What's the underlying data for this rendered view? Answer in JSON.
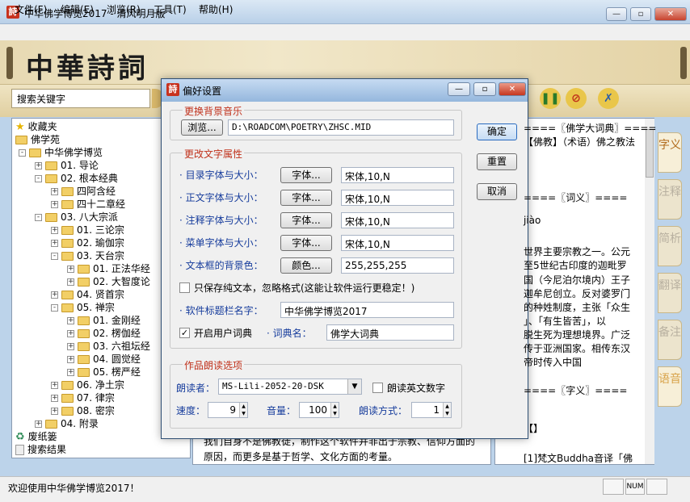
{
  "window": {
    "title": "中华佛学博览2017 - 清风明月版"
  },
  "menu": [
    "文件(F)",
    "编辑(E)",
    "浏览(R)",
    "工具(T)",
    "帮助(H)"
  ],
  "banner": {
    "logo": "中華詩詞"
  },
  "search": {
    "placeholder": "搜索关键字"
  },
  "tree": [
    {
      "label": "收藏夹",
      "level": 0,
      "icon": "star-icon",
      "exp": ""
    },
    {
      "label": "佛学苑",
      "level": 0,
      "icon": "folder-icon",
      "exp": ""
    },
    {
      "label": "中华佛学博览",
      "level": 1,
      "icon": "folder-icon",
      "exp": "-"
    },
    {
      "label": "01. 导论",
      "level": 2,
      "icon": "folder-icon",
      "exp": "+"
    },
    {
      "label": "02. 根本经典",
      "level": 2,
      "icon": "folder-icon",
      "exp": "-"
    },
    {
      "label": "四阿含经",
      "level": 3,
      "icon": "folder-icon",
      "exp": "+"
    },
    {
      "label": "四十二章经",
      "level": 3,
      "icon": "folder-icon",
      "exp": "+"
    },
    {
      "label": "03. 八大宗派",
      "level": 2,
      "icon": "folder-icon",
      "exp": "-"
    },
    {
      "label": "01. 三论宗",
      "level": 3,
      "icon": "folder-icon",
      "exp": "+"
    },
    {
      "label": "02. 瑜伽宗",
      "level": 3,
      "icon": "folder-icon",
      "exp": "+"
    },
    {
      "label": "03. 天台宗",
      "level": 3,
      "icon": "folder-icon",
      "exp": "-"
    },
    {
      "label": "01. 正法华经",
      "level": 4,
      "icon": "folder-icon",
      "exp": "+"
    },
    {
      "label": "02. 大智度论",
      "level": 4,
      "icon": "folder-icon",
      "exp": "+"
    },
    {
      "label": "04. 贤首宗",
      "level": 3,
      "icon": "folder-icon",
      "exp": "+"
    },
    {
      "label": "05. 禅宗",
      "level": 3,
      "icon": "folder-icon",
      "exp": "-"
    },
    {
      "label": "01. 金刚经",
      "level": 4,
      "icon": "folder-icon",
      "exp": "+"
    },
    {
      "label": "02. 楞伽经",
      "level": 4,
      "icon": "folder-icon",
      "exp": "+"
    },
    {
      "label": "03. 六祖坛经",
      "level": 4,
      "icon": "folder-icon",
      "exp": "+"
    },
    {
      "label": "04. 圆觉经",
      "level": 4,
      "icon": "folder-icon",
      "exp": "+"
    },
    {
      "label": "05. 楞严经",
      "level": 4,
      "icon": "folder-icon",
      "exp": "+"
    },
    {
      "label": "06. 净土宗",
      "level": 3,
      "icon": "folder-icon",
      "exp": "+"
    },
    {
      "label": "07. 律宗",
      "level": 3,
      "icon": "folder-icon",
      "exp": "+"
    },
    {
      "label": "08. 密宗",
      "level": 3,
      "icon": "folder-icon",
      "exp": "+"
    },
    {
      "label": "04. 附录",
      "level": 2,
      "icon": "folder-icon",
      "exp": "+"
    },
    {
      "label": "废纸篓",
      "level": 0,
      "icon": "recycle-icon",
      "exp": ""
    },
    {
      "label": "搜索结果",
      "level": 0,
      "icon": "doc-icon",
      "exp": ""
    }
  ],
  "middle": {
    "text": "我们自身不是佛教徒，制作这个软件并非出于宗教、信仰方面的原因，而更多是基于哲学、文化方面的考量。"
  },
  "right": {
    "lines": [
      "====〖佛学大词典〗====",
      "【佛教】（术语）佛之教法",
      "====〖词义〗====",
      "jiào",
      "世界主要宗教之一。公元",
      "至5世纪古印度的迦毗罗",
      "国（今尼泊尔境内）王子",
      "迦牟尼创立。反对婆罗门",
      "的种姓制度，主张「众生",
      "」、「有生皆苦」，以",
      "脱生死为理想境界。广泛",
      "传于亚洲国家。相传东汉",
      "帝时传入中国",
      "====〖字义〗====",
      "【】",
      "[1]梵文Buddha音译「佛"
    ]
  },
  "side_tabs": [
    "字义",
    "注释",
    "简析",
    "翻译",
    "备注",
    "语音"
  ],
  "status": {
    "text": "欢迎使用中华佛学博览2017！",
    "num": "NUM"
  },
  "dialog": {
    "title": "偏好设置",
    "music_group": "更换背景音乐",
    "browse_btn": "浏览...",
    "music_path": "D:\\ROADCOM\\POETRY\\ZHSC.MID",
    "text_group": "更改文字属性",
    "font_btn": "字体...",
    "color_btn": "颜色...",
    "rows": [
      {
        "label": "· 目录字体与大小：",
        "value": "宋体,10,N"
      },
      {
        "label": "· 正文字体与大小：",
        "value": "宋体,10,N"
      },
      {
        "label": "· 注释字体与大小：",
        "value": "宋体,10,N"
      },
      {
        "label": "· 菜单字体与大小：",
        "value": "宋体,10,N"
      },
      {
        "label": "· 文本框的背景色：",
        "value": "255,255,255"
      }
    ],
    "plain_text_check": "只保存纯文本，忽略格式(这能让软件运行更稳定！)",
    "plain_text_checked": false,
    "title_label": "· 软件标题栏名字：",
    "title_value": "中华佛学博览2017",
    "user_dict_check": "开启用户词典",
    "user_dict_checked": true,
    "dict_label": "· 词典名：",
    "dict_value": "佛学大词典",
    "read_group": "作品朗读选项",
    "reader_label": "朗读者：",
    "reader_value": "MS-Lili-2052-20-DSK",
    "read_en_check": "朗读英文数字",
    "read_en_checked": false,
    "speed_label": "速度：",
    "speed_value": "9",
    "volume_label": "音量：",
    "volume_value": "100",
    "mode_label": "朗读方式：",
    "mode_value": "1",
    "ok": "确定",
    "reset": "重置",
    "cancel": "取消"
  }
}
